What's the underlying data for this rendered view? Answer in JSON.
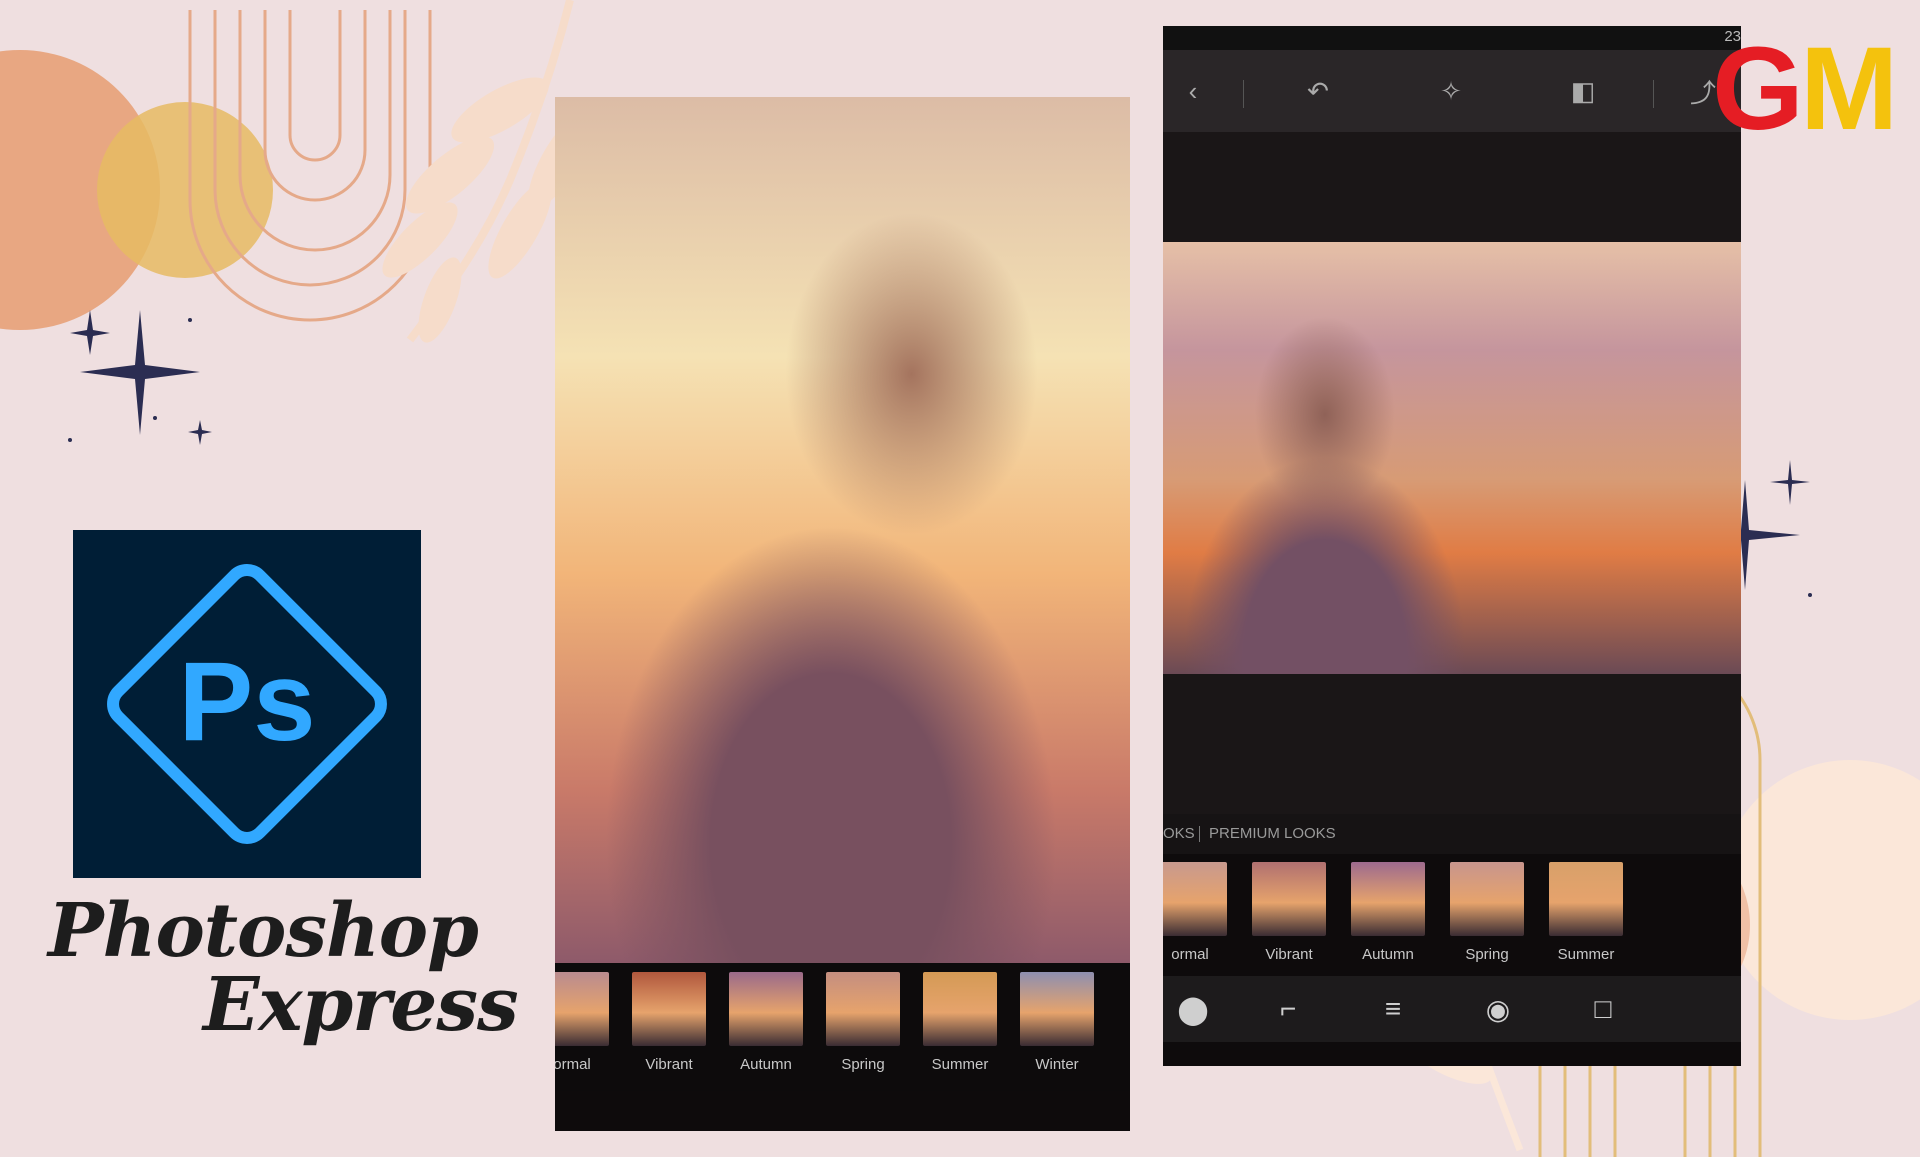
{
  "brand": {
    "logo_text": "Ps",
    "title_line1": "Photoshop",
    "title_line2": "Express",
    "watermark_g": "G",
    "watermark_m": "M"
  },
  "left_phone": {
    "filters": [
      {
        "label": "ormal",
        "tint": "#b98b8f"
      },
      {
        "label": "Vibrant",
        "tint": "#b0573d"
      },
      {
        "label": "Autumn",
        "tint": "#9a6a8a"
      },
      {
        "label": "Spring",
        "tint": "#c48e80"
      },
      {
        "label": "Summer",
        "tint": "#d49a55"
      },
      {
        "label": "Winter",
        "tint": "#8e8fb0"
      }
    ]
  },
  "right_phone": {
    "status_time": "23",
    "toolbar": [
      "back-icon",
      "undo-icon",
      "magic-wand-icon",
      "compare-icon",
      "share-icon"
    ],
    "looks_tab": "OKS",
    "premium_looks_tab": "PREMIUM LOOKS",
    "filters": [
      {
        "label": "ormal",
        "tint": "#c8998e"
      },
      {
        "label": "Vibrant",
        "tint": "#b07070"
      },
      {
        "label": "Autumn",
        "tint": "#9d6a8e"
      },
      {
        "label": "Spring",
        "tint": "#c8958d"
      },
      {
        "label": "Summer",
        "tint": "#d8a06a"
      }
    ],
    "bottom_tools": [
      "looks-icon",
      "crop-icon",
      "adjust-icon",
      "eye-icon",
      "frame-icon"
    ]
  },
  "colors": {
    "background": "#efdfe0",
    "ps_tile": "#001e36",
    "ps_blue": "#31a8ff",
    "peach": "#e8a782",
    "mustard": "#e6bb63",
    "navy_star": "#2b2d52"
  }
}
